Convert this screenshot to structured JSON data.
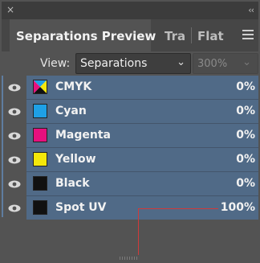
{
  "window": {
    "close_glyph": "×",
    "collapse_glyph": "‹‹"
  },
  "tabs": [
    {
      "label": "Separations Preview",
      "active": true
    },
    {
      "label": "Tra",
      "active": false
    },
    {
      "label": "Flat",
      "active": false
    }
  ],
  "view": {
    "label": "View:",
    "selected": "Separations",
    "zoom": "300%",
    "zoom_disabled": true
  },
  "separations": [
    {
      "name": "CMYK",
      "percent": "0%",
      "swatch": "cmyk-icon",
      "visible": true
    },
    {
      "name": "Cyan",
      "percent": "0%",
      "swatch_color": "#1ea0e6",
      "visible": true
    },
    {
      "name": "Magenta",
      "percent": "0%",
      "swatch_color": "#e6107e",
      "visible": true
    },
    {
      "name": "Yellow",
      "percent": "0%",
      "swatch_color": "#f4e80a",
      "visible": true
    },
    {
      "name": "Black",
      "percent": "0%",
      "swatch_color": "#111111",
      "visible": true
    },
    {
      "name": "Spot UV",
      "percent": "100%",
      "swatch_color": "#111111",
      "visible": true
    }
  ],
  "colors": {
    "row_highlight": "#506a87",
    "panel_bg": "#535353",
    "tab_bar_bg": "#464646",
    "annotation_line": "#d03a3a"
  }
}
